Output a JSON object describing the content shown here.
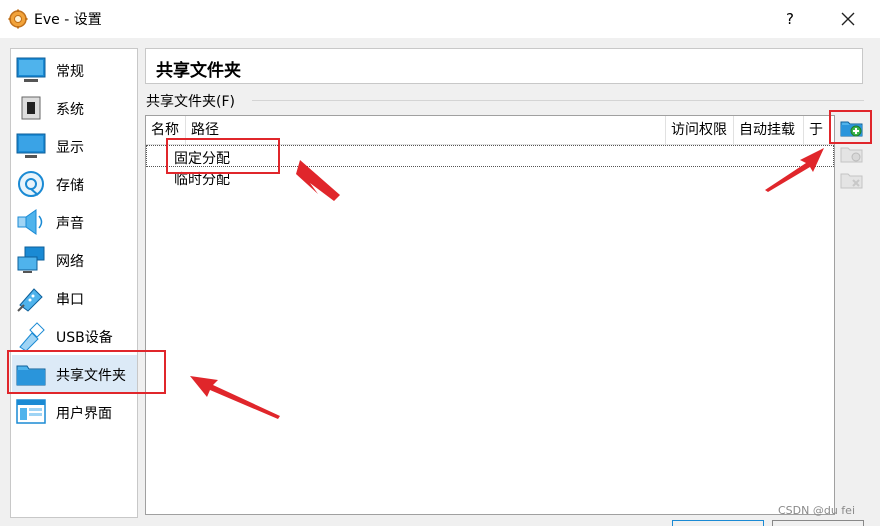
{
  "window": {
    "title": "Eve - 设置",
    "help_label": "?",
    "close_icon": "close-icon",
    "app_icon": "virtualbox-gear-icon"
  },
  "sidebar": {
    "items": [
      {
        "label": "常规",
        "icon": "general-monitor-icon",
        "selected": false
      },
      {
        "label": "系统",
        "icon": "chip-icon",
        "selected": false
      },
      {
        "label": "显示",
        "icon": "display-icon",
        "selected": false
      },
      {
        "label": "存储",
        "icon": "disk-icon",
        "selected": false
      },
      {
        "label": "声音",
        "icon": "speaker-icon",
        "selected": false
      },
      {
        "label": "网络",
        "icon": "network-icon",
        "selected": false
      },
      {
        "label": "串口",
        "icon": "serial-port-icon",
        "selected": false
      },
      {
        "label": "USB设备",
        "icon": "usb-icon",
        "selected": false
      },
      {
        "label": "共享文件夹",
        "icon": "folder-icon",
        "selected": true
      },
      {
        "label": "用户界面",
        "icon": "user-interface-icon",
        "selected": false
      }
    ]
  },
  "main": {
    "page_title": "共享文件夹",
    "group_label": "共享文件夹(F)",
    "columns": [
      "名称",
      "路径",
      "访问权限",
      "自动挂载",
      "于"
    ],
    "rows": [
      {
        "name": "固定分配",
        "selected": true
      },
      {
        "name": "临时分配",
        "selected": false
      }
    ],
    "toolbar": {
      "add": "add-shared-folder-icon",
      "edit": "edit-shared-folder-icon",
      "remove": "remove-shared-folder-icon"
    }
  },
  "colors": {
    "selection": "#dceaf7",
    "annotation_red": "#e0262b",
    "accent_blue": "#1a8ad4"
  },
  "watermark": "CSDN @du fei"
}
